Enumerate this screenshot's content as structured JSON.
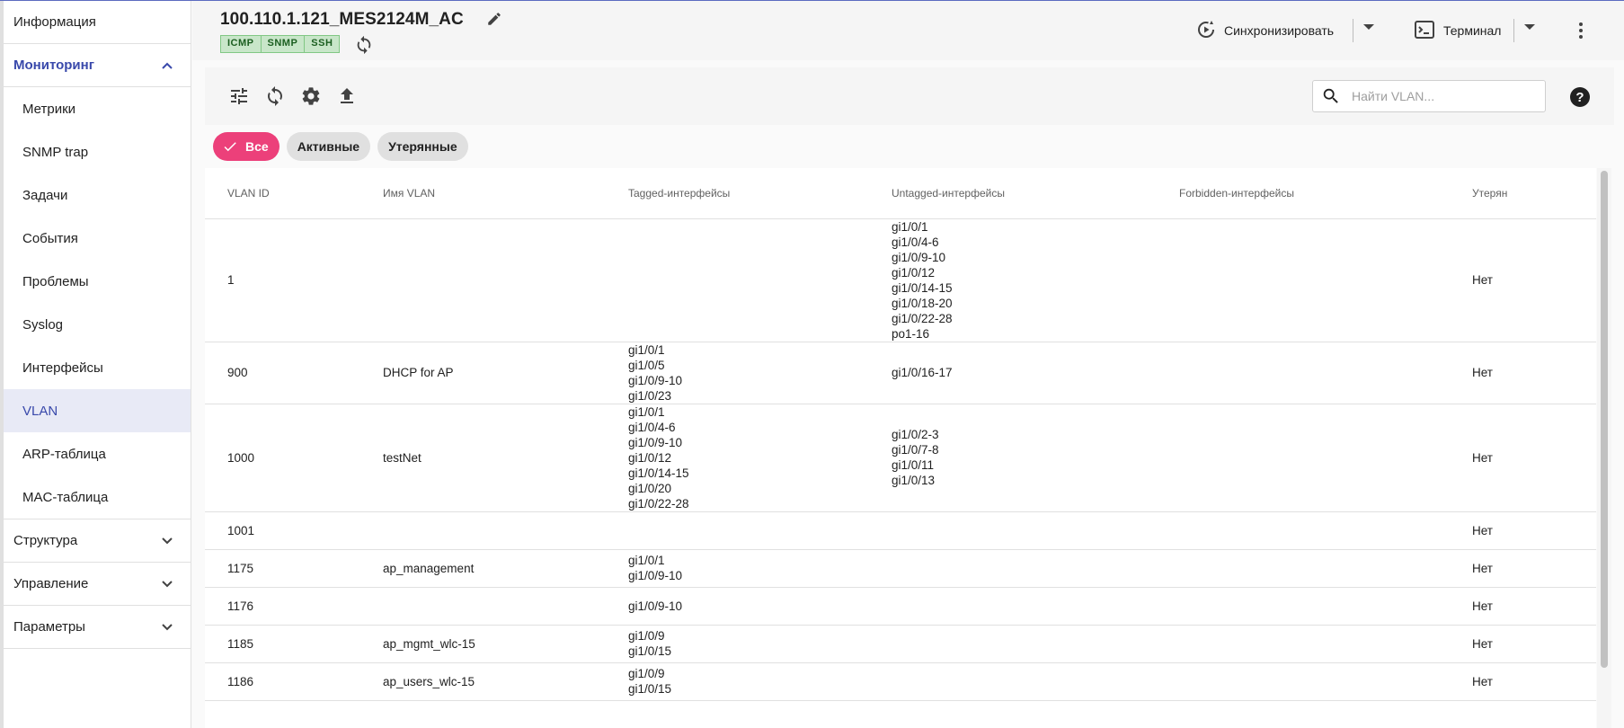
{
  "sidebar": {
    "info": "Информация",
    "monitoring": "Мониторинг",
    "items": [
      "Метрики",
      "SNMP trap",
      "Задачи",
      "События",
      "Проблемы",
      "Syslog",
      "Интерфейсы",
      "VLAN",
      "ARP-таблица",
      "MAC-таблица"
    ],
    "selected": "VLAN",
    "structure": "Структура",
    "management": "Управление",
    "parameters": "Параметры"
  },
  "header": {
    "title": "100.110.1.121_MES2124M_AC",
    "badges": [
      "ICMP",
      "SNMP",
      "SSH"
    ],
    "sync_label": "Синхронизировать",
    "terminal_label": "Терминал"
  },
  "toolbar": {
    "search_placeholder": "Найти VLAN...",
    "help": "?"
  },
  "filters": {
    "all": "Все",
    "active": "Активные",
    "lost": "Утерянные"
  },
  "table": {
    "headers": [
      "VLAN ID",
      "Имя VLAN",
      "Tagged-интерфейсы",
      "Untagged-интерфейсы",
      "Forbidden-интерфейсы",
      "Утерян"
    ],
    "rows": [
      {
        "id": "1",
        "name": "",
        "tagged": [],
        "untagged": [
          "gi1/0/1",
          "gi1/0/4-6",
          "gi1/0/9-10",
          "gi1/0/12",
          "gi1/0/14-15",
          "gi1/0/18-20",
          "gi1/0/22-28",
          "po1-16"
        ],
        "forbidden": [],
        "lost": "Нет"
      },
      {
        "id": "900",
        "name": "DHCP for AP",
        "tagged": [
          "gi1/0/1",
          "gi1/0/5",
          "gi1/0/9-10",
          "gi1/0/23"
        ],
        "untagged": [
          "gi1/0/16-17"
        ],
        "forbidden": [],
        "lost": "Нет"
      },
      {
        "id": "1000",
        "name": "testNet",
        "tagged": [
          "gi1/0/1",
          "gi1/0/4-6",
          "gi1/0/9-10",
          "gi1/0/12",
          "gi1/0/14-15",
          "gi1/0/20",
          "gi1/0/22-28"
        ],
        "untagged": [
          "gi1/0/2-3",
          "gi1/0/7-8",
          "gi1/0/11",
          "gi1/0/13"
        ],
        "forbidden": [],
        "lost": "Нет"
      },
      {
        "id": "1001",
        "name": "",
        "tagged": [],
        "untagged": [],
        "forbidden": [],
        "lost": "Нет"
      },
      {
        "id": "1175",
        "name": "ap_management",
        "tagged": [
          "gi1/0/1",
          "gi1/0/9-10"
        ],
        "untagged": [],
        "forbidden": [],
        "lost": "Нет"
      },
      {
        "id": "1176",
        "name": "",
        "tagged": [
          "gi1/0/9-10"
        ],
        "untagged": [],
        "forbidden": [],
        "lost": "Нет"
      },
      {
        "id": "1185",
        "name": "ap_mgmt_wlc-15",
        "tagged": [
          "gi1/0/9",
          "gi1/0/15"
        ],
        "untagged": [],
        "forbidden": [],
        "lost": "Нет"
      },
      {
        "id": "1186",
        "name": "ap_users_wlc-15",
        "tagged": [
          "gi1/0/9",
          "gi1/0/15"
        ],
        "untagged": [],
        "forbidden": [],
        "lost": "Нет"
      }
    ]
  },
  "colors": {
    "accent": "#3949ab",
    "chip_active": "#ec407a",
    "badge_bg": "#c8e6c9"
  }
}
